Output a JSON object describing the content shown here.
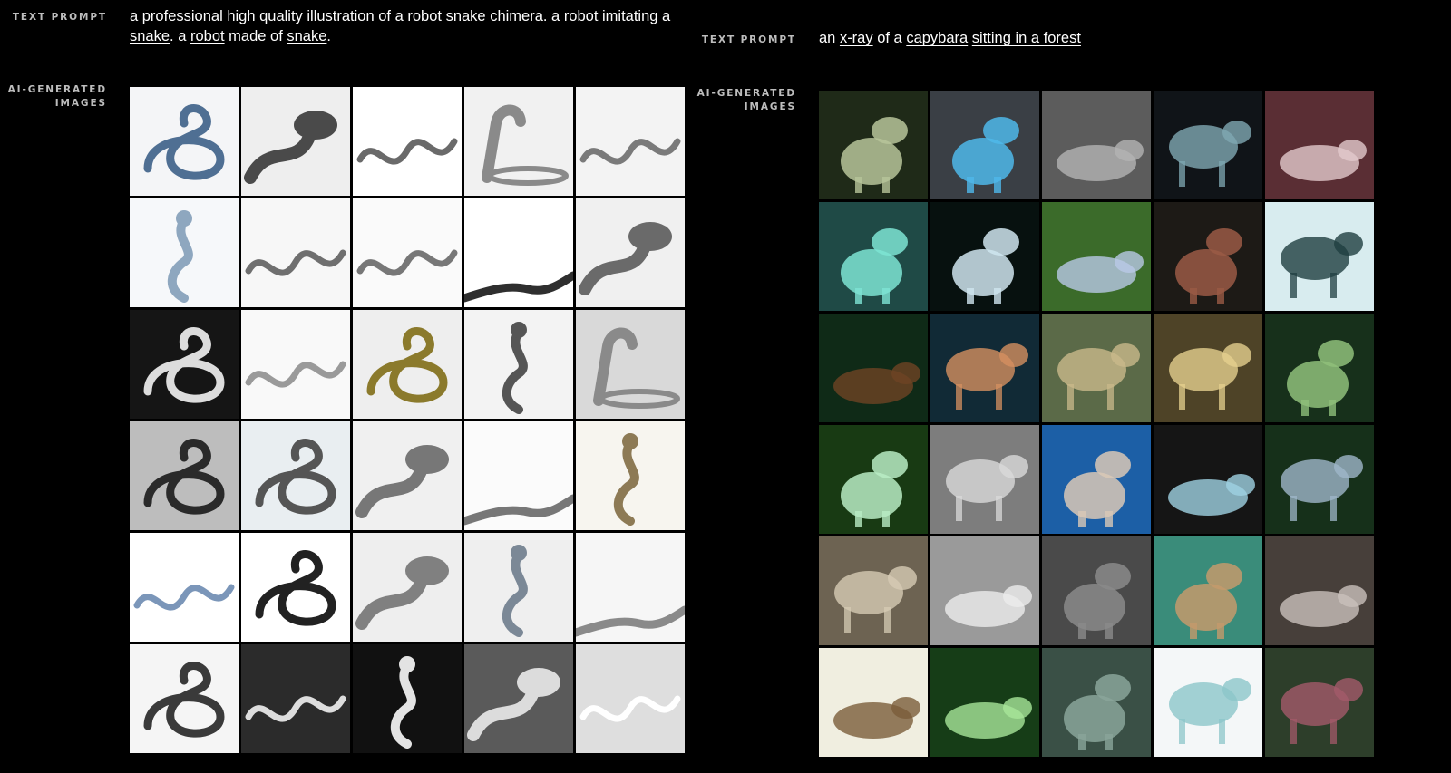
{
  "left_panel": {
    "text_prompt_label": "TEXT PROMPT",
    "images_label_lines": [
      "AI-GENERATED",
      "IMAGES"
    ],
    "prompt_segments": [
      {
        "text": "a professional high quality ",
        "kw": false
      },
      {
        "text": "illustration",
        "kw": true
      },
      {
        "text": " of a ",
        "kw": false
      },
      {
        "text": "robot",
        "kw": true
      },
      {
        "text": " ",
        "kw": false
      },
      {
        "text": "snake",
        "kw": true
      },
      {
        "text": " chimera. a ",
        "kw": false
      },
      {
        "text": "robot",
        "kw": true
      },
      {
        "text": " imitating a ",
        "kw": false
      },
      {
        "text": "snake",
        "kw": true
      },
      {
        "text": ". a ",
        "kw": false
      },
      {
        "text": "robot",
        "kw": true
      },
      {
        "text": " made of ",
        "kw": false
      },
      {
        "text": "snake",
        "kw": true
      },
      {
        "text": ".",
        "kw": false
      }
    ],
    "images": [
      {
        "bg": "#f4f5f7",
        "fg": "#4f6f93",
        "shape": "coil"
      },
      {
        "bg": "#eeeeee",
        "fg": "#4a4a4a",
        "shape": "head"
      },
      {
        "bg": "#ffffff",
        "fg": "#6a6a6a",
        "shape": "wave"
      },
      {
        "bg": "#f1f1f1",
        "fg": "#8a8a8a",
        "shape": "arch"
      },
      {
        "bg": "#f3f3f3",
        "fg": "#7a7a7a",
        "shape": "wave"
      },
      {
        "bg": "#f6f8fa",
        "fg": "#8ea7bf",
        "shape": "upright"
      },
      {
        "bg": "#f7f7f7",
        "fg": "#6f6f6f",
        "shape": "wave"
      },
      {
        "bg": "#fafafa",
        "fg": "#777777",
        "shape": "wave"
      },
      {
        "bg": "#ffffff",
        "fg": "#2f2f2f",
        "shape": "low"
      },
      {
        "bg": "#f0f0f0",
        "fg": "#6a6a6a",
        "shape": "head"
      },
      {
        "bg": "#151515",
        "fg": "#dcdcdc",
        "shape": "coil"
      },
      {
        "bg": "#f9f9f9",
        "fg": "#9a9a9a",
        "shape": "wave"
      },
      {
        "bg": "#eeeeee",
        "fg": "#8b7a2c",
        "shape": "coil"
      },
      {
        "bg": "#f3f3f3",
        "fg": "#555555",
        "shape": "upright"
      },
      {
        "bg": "#d9d9d9",
        "fg": "#8a8a8a",
        "shape": "arch"
      },
      {
        "bg": "#bdbdbd",
        "fg": "#2a2a2a",
        "shape": "coil"
      },
      {
        "bg": "#e9eef1",
        "fg": "#555555",
        "shape": "coil"
      },
      {
        "bg": "#f0f0f0",
        "fg": "#777777",
        "shape": "head"
      },
      {
        "bg": "#fbfbfb",
        "fg": "#777777",
        "shape": "low"
      },
      {
        "bg": "#f7f5ef",
        "fg": "#8d7a55",
        "shape": "upright"
      },
      {
        "bg": "#ffffff",
        "fg": "#7b96b9",
        "shape": "wave"
      },
      {
        "bg": "#ffffff",
        "fg": "#222222",
        "shape": "coil"
      },
      {
        "bg": "#eeeeee",
        "fg": "#808080",
        "shape": "head"
      },
      {
        "bg": "#efefef",
        "fg": "#7b8896",
        "shape": "upright"
      },
      {
        "bg": "#f6f6f6",
        "fg": "#8a8a8a",
        "shape": "low"
      },
      {
        "bg": "#f5f5f5",
        "fg": "#3a3a3a",
        "shape": "coil"
      },
      {
        "bg": "#2b2b2b",
        "fg": "#dddddd",
        "shape": "wave"
      },
      {
        "bg": "#111111",
        "fg": "#e3e3e3",
        "shape": "upright"
      },
      {
        "bg": "#5a5a5a",
        "fg": "#dcdcdc",
        "shape": "head"
      },
      {
        "bg": "#dedede",
        "fg": "#ffffff",
        "shape": "wave"
      }
    ]
  },
  "right_panel": {
    "text_prompt_label": "TEXT PROMPT",
    "images_label_lines": [
      "AI-GENERATED",
      "IMAGES"
    ],
    "prompt_segments": [
      {
        "text": "an ",
        "kw": false
      },
      {
        "text": "x-ray",
        "kw": true
      },
      {
        "text": " of a ",
        "kw": false
      },
      {
        "text": "capybara",
        "kw": true
      },
      {
        "text": " ",
        "kw": false
      },
      {
        "text": "sitting in a forest",
        "kw": true
      }
    ],
    "images": [
      {
        "bg": "#1f2a18",
        "fg": "#b7c49a",
        "shape": "sit"
      },
      {
        "bg": "#3a3f45",
        "fg": "#4fb8ea",
        "shape": "sit"
      },
      {
        "bg": "#5c5c5c",
        "fg": "#b4b4b4",
        "shape": "lying"
      },
      {
        "bg": "#101418",
        "fg": "#7fa8b3",
        "shape": "stand"
      },
      {
        "bg": "#5a2e34",
        "fg": "#e2c9cc",
        "shape": "lying"
      },
      {
        "bg": "#1f4a46",
        "fg": "#7ee4d4",
        "shape": "sit"
      },
      {
        "bg": "#07110f",
        "fg": "#cfe5ef",
        "shape": "sit"
      },
      {
        "bg": "#3b6b2a",
        "fg": "#b9c9e6",
        "shape": "lying"
      },
      {
        "bg": "#1d1a16",
        "fg": "#9a5a45",
        "shape": "sit"
      },
      {
        "bg": "#d8ecef",
        "fg": "#1f3e40",
        "shape": "stand"
      },
      {
        "bg": "#0f2a17",
        "fg": "#6e4424",
        "shape": "lying"
      },
      {
        "bg": "#112a36",
        "fg": "#d59060",
        "shape": "stand"
      },
      {
        "bg": "#5b6a48",
        "fg": "#c9b98b",
        "shape": "stand"
      },
      {
        "bg": "#4e4327",
        "fg": "#e5d08f",
        "shape": "stand"
      },
      {
        "bg": "#17301b",
        "fg": "#8fbf7a",
        "shape": "sit"
      },
      {
        "bg": "#183a13",
        "fg": "#b9ecc4",
        "shape": "sit"
      },
      {
        "bg": "#7d7d7d",
        "fg": "#d9d9d9",
        "shape": "stand"
      },
      {
        "bg": "#1c5fa6",
        "fg": "#d9c8b6",
        "shape": "sit"
      },
      {
        "bg": "#151515",
        "fg": "#9fd2e2",
        "shape": "lying"
      },
      {
        "bg": "#16301a",
        "fg": "#9fb7c9",
        "shape": "stand"
      },
      {
        "bg": "#6d6352",
        "fg": "#d6cbb4",
        "shape": "stand"
      },
      {
        "bg": "#9a9a9a",
        "fg": "#ececec",
        "shape": "lying"
      },
      {
        "bg": "#4a4a4a",
        "fg": "#8a8a8a",
        "shape": "sit"
      },
      {
        "bg": "#3a8c7a",
        "fg": "#c49a6c",
        "shape": "sit"
      },
      {
        "bg": "#473f3a",
        "fg": "#c9c0bb",
        "shape": "lying"
      },
      {
        "bg": "#f0eee0",
        "fg": "#7a5c3a",
        "shape": "lying"
      },
      {
        "bg": "#163d17",
        "fg": "#a8e69a",
        "shape": "lying"
      },
      {
        "bg": "#3a5046",
        "fg": "#8aa59a",
        "shape": "sit"
      },
      {
        "bg": "#f4f7f8",
        "fg": "#8cc6c9",
        "shape": "stand"
      },
      {
        "bg": "#2d3e2a",
        "fg": "#a35a6a",
        "shape": "stand"
      }
    ]
  }
}
